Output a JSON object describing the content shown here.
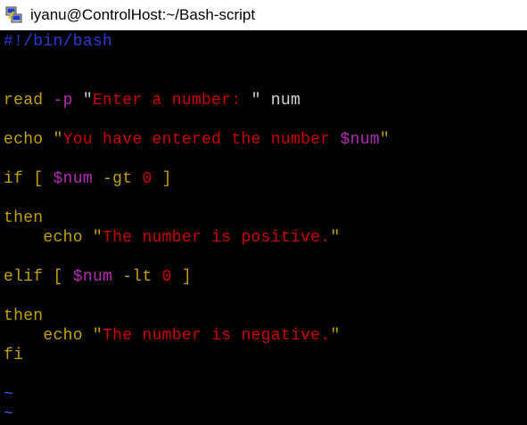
{
  "window": {
    "title": "iyanu@ControlHost:~/Bash-script"
  },
  "colors": {
    "keyword": "#c4a000",
    "string": "#cc0000",
    "variable": "#b52ab5",
    "plain": "#d3d7cf",
    "shebang": "#2a3bd6",
    "tilde": "#3b57ff",
    "background": "#000000"
  },
  "editor": {
    "lines": [
      [
        {
          "t": "#!/bin/bash",
          "c": "shebang"
        }
      ],
      [],
      [],
      [
        {
          "t": "read ",
          "c": "kw"
        },
        {
          "t": "-p ",
          "c": "var"
        },
        {
          "t": "\"",
          "c": "plain"
        },
        {
          "t": "Enter a number: ",
          "c": "str"
        },
        {
          "t": "\" num",
          "c": "plain"
        }
      ],
      [],
      [
        {
          "t": "echo ",
          "c": "kw"
        },
        {
          "t": "\"",
          "c": "kw"
        },
        {
          "t": "You have entered the number ",
          "c": "str"
        },
        {
          "t": "$num",
          "c": "var"
        },
        {
          "t": "\"",
          "c": "kw"
        }
      ],
      [],
      [
        {
          "t": "if ",
          "c": "kw"
        },
        {
          "t": "[ ",
          "c": "kw"
        },
        {
          "t": "$num",
          "c": "var"
        },
        {
          "t": " -gt ",
          "c": "kw"
        },
        {
          "t": "0",
          "c": "str"
        },
        {
          "t": " ]",
          "c": "kw"
        }
      ],
      [],
      [
        {
          "t": "then",
          "c": "kw"
        }
      ],
      [
        {
          "t": "    echo ",
          "c": "kw"
        },
        {
          "t": "\"",
          "c": "kw"
        },
        {
          "t": "The number is positive.",
          "c": "str"
        },
        {
          "t": "\"",
          "c": "kw"
        }
      ],
      [],
      [
        {
          "t": "elif ",
          "c": "kw"
        },
        {
          "t": "[ ",
          "c": "kw"
        },
        {
          "t": "$num",
          "c": "var"
        },
        {
          "t": " -lt ",
          "c": "kw"
        },
        {
          "t": "0",
          "c": "str"
        },
        {
          "t": " ]",
          "c": "kw"
        }
      ],
      [],
      [
        {
          "t": "then",
          "c": "kw"
        }
      ],
      [
        {
          "t": "    echo ",
          "c": "kw"
        },
        {
          "t": "\"",
          "c": "kw"
        },
        {
          "t": "The number is negative.",
          "c": "str"
        },
        {
          "t": "\"",
          "c": "kw"
        }
      ],
      [
        {
          "t": "fi",
          "c": "kw"
        }
      ],
      [],
      [
        {
          "t": "~",
          "c": "tilde"
        }
      ],
      [
        {
          "t": "~",
          "c": "tilde"
        }
      ]
    ]
  }
}
